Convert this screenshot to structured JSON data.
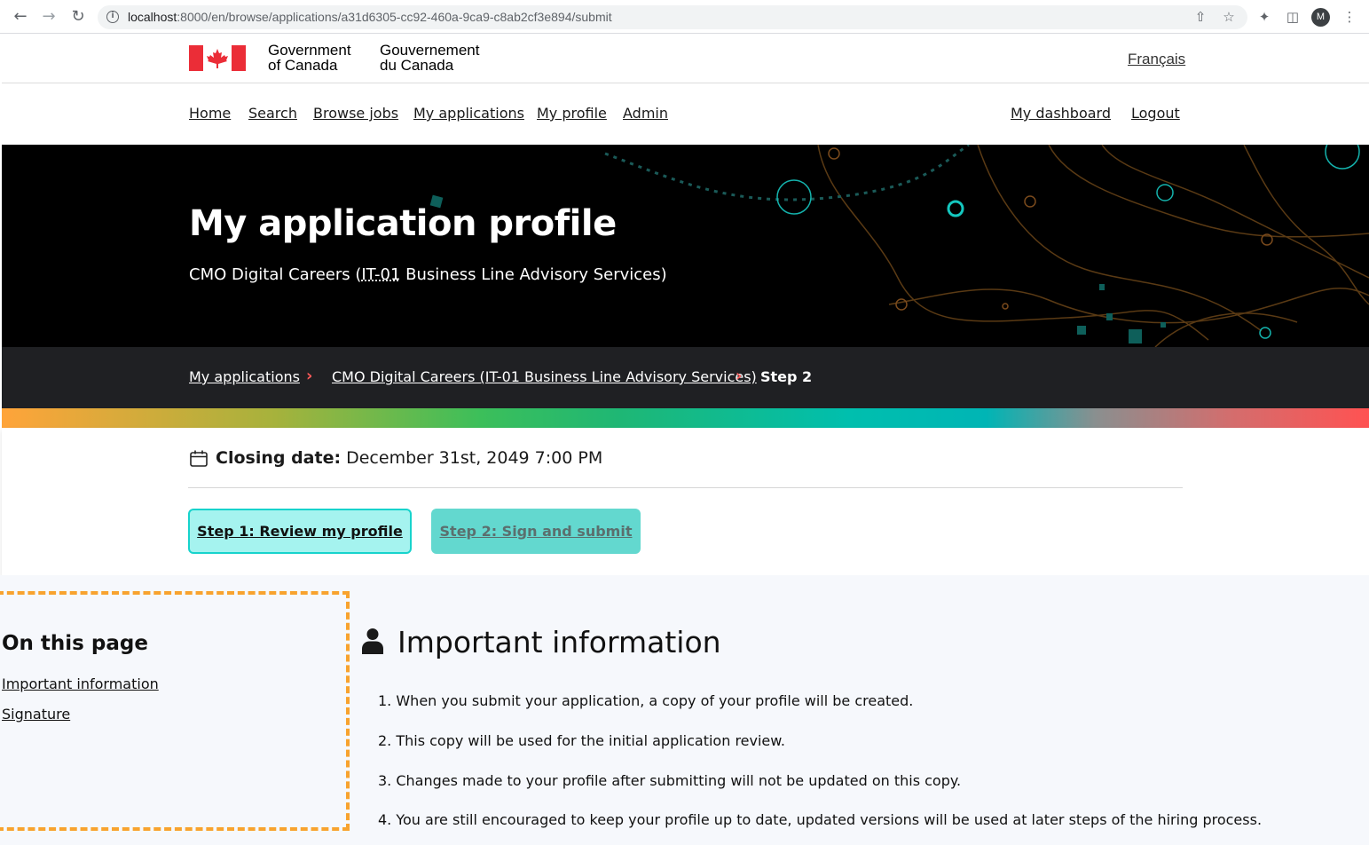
{
  "browser": {
    "url_host": "localhost",
    "url_rest": ":8000/en/browse/applications/a31d6305-cc92-460a-9ca9-c8ab2cf3e894/submit",
    "profile_initial": "M"
  },
  "gov_header": {
    "en_line1": "Government",
    "en_line2": "of Canada",
    "fr_line1": "Gouvernement",
    "fr_line2": "du Canada",
    "language_toggle": "Français"
  },
  "nav": {
    "items": [
      "Home",
      "Search",
      "Browse jobs",
      "My applications",
      "My profile",
      "Admin"
    ],
    "dashboard": "My dashboard",
    "logout": "Logout"
  },
  "hero": {
    "title": "My application profile",
    "subtitle_prefix": "CMO Digital Careers (",
    "subtitle_abbr": "IT-01",
    "subtitle_suffix": " Business Line Advisory Services)"
  },
  "breadcrumb": {
    "items": [
      "My applications",
      "CMO Digital Careers (IT-01 Business Line Advisory Services)"
    ],
    "current": "Step 2"
  },
  "closing": {
    "label": "Closing date:",
    "value": "December 31st, 2049 7:00 PM"
  },
  "steps": {
    "step1": "Step 1: Review my profile",
    "step2": "Step 2: Sign and submit"
  },
  "sidebar": {
    "title": "On this page",
    "links": [
      "Important information",
      "Signature"
    ]
  },
  "important": {
    "title": "Important information",
    "items": [
      "1. When you submit your application, a copy of your profile will be created.",
      "2. This copy will be used for the initial application review.",
      "3. Changes made to your profile after submitting will not be updated on this copy.",
      "4. You are still encouraged to keep your profile up to date, updated versions will be used at later steps of the hiring process."
    ]
  },
  "colors": {
    "step1_bg": "#a5f3ef",
    "step1_border": "#17d3cc",
    "step2_bg": "#63d8cf",
    "breadcrumb_chevron": "#ff5a5a",
    "sidebar_dash": "#f8a32e",
    "hero_bg": "#000000"
  }
}
